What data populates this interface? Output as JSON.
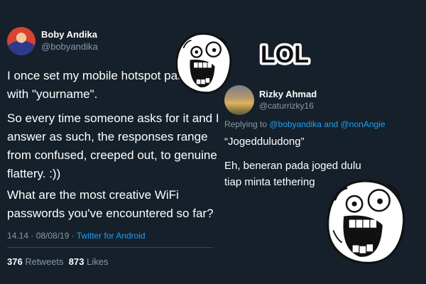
{
  "left_tweet": {
    "name": "Boby Andika",
    "handle": "@bobyandika",
    "paragraphs": [
      "I once set my mobile hotspot password with \"yourname\".",
      "So every time someone asks for it and I answer as such, the responses range from confused, creeped out, to genuine flattery. :))",
      "What are the most creative WiFi passwords you've encountered so far?"
    ],
    "timestamp": "14.14 · 08/08/19 · ",
    "source": "Twitter for Android",
    "retweets_count": "376",
    "retweets_label": "Retweets",
    "likes_count": "873",
    "likes_label": "Likes"
  },
  "right_tweet": {
    "name": "Rizky Ahmad",
    "handle": "@caturrizky16",
    "reply_prefix": "Replying to ",
    "reply_mentions": "@bobyandika and @nonAngie",
    "lines": [
      "“Jogedduludong”",
      "Eh, beneran pada joged dulu tiap minta tethering"
    ]
  },
  "sticker": {
    "text": "LOL"
  },
  "colors": {
    "background": "#15202b",
    "secondary_text": "#8899a6",
    "link": "#1da1f2"
  }
}
